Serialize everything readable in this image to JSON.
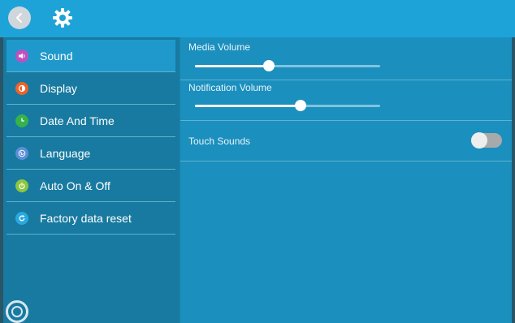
{
  "header": {
    "back_icon": "chevron-left-icon",
    "settings_icon": "gear-icon"
  },
  "sidebar": {
    "items": [
      {
        "label": "Sound",
        "icon": "speaker-icon",
        "icon_color": "#c04fc4",
        "active": true
      },
      {
        "label": "Display",
        "icon": "display-icon",
        "icon_color": "#f0622a",
        "active": false
      },
      {
        "label": "Date And Time",
        "icon": "clock-icon",
        "icon_color": "#36b24a",
        "active": false
      },
      {
        "label": "Language",
        "icon": "globe-icon",
        "icon_color": "#5b8fd6",
        "active": false
      },
      {
        "label": "Auto On & Off",
        "icon": "power-icon",
        "icon_color": "#8dc63f",
        "active": false
      },
      {
        "label": "Factory data reset",
        "icon": "refresh-icon",
        "icon_color": "#2aa9e0",
        "active": false
      }
    ]
  },
  "sound": {
    "media_volume": {
      "label": "Media Volume",
      "level": 0.4
    },
    "notification_volume": {
      "label": "Notification Volume",
      "level": 0.57
    },
    "touch_sounds": {
      "label": "Touch Sounds",
      "enabled": false
    }
  },
  "colors": {
    "topbar": "#1ea3d9",
    "active_item": "#1f99cc",
    "panel": "#1b8fbd"
  }
}
